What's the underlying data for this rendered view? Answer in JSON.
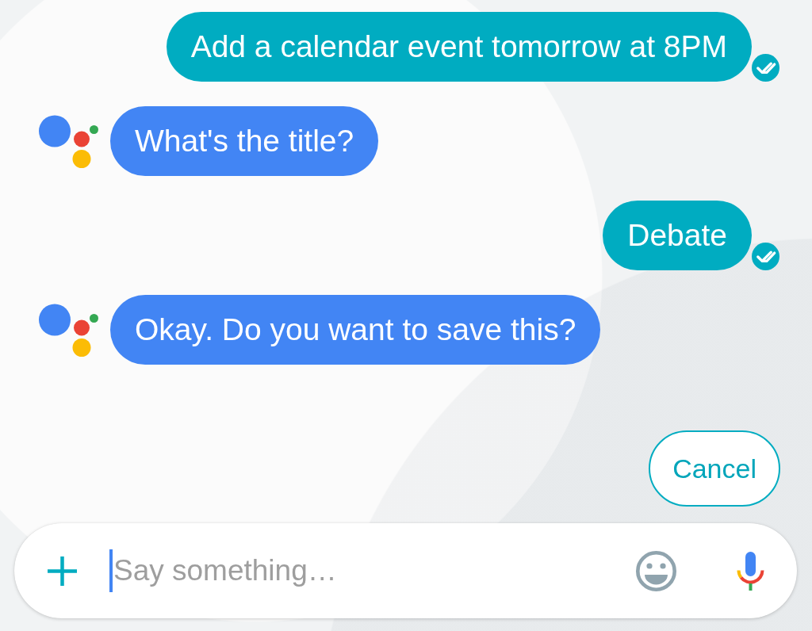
{
  "messages": [
    {
      "kind": "user",
      "text": "Add a calendar event tomorrow at 8PM",
      "delivered": true
    },
    {
      "kind": "assistant",
      "text": "What's the title?",
      "delivered": false
    },
    {
      "kind": "user",
      "text": "Debate",
      "delivered": true
    },
    {
      "kind": "assistant",
      "text": "Okay. Do you want to save this?",
      "delivered": false
    }
  ],
  "suggestions": [
    {
      "label": "Cancel"
    }
  ],
  "composer": {
    "placeholder": "Say something…",
    "focused": true
  }
}
